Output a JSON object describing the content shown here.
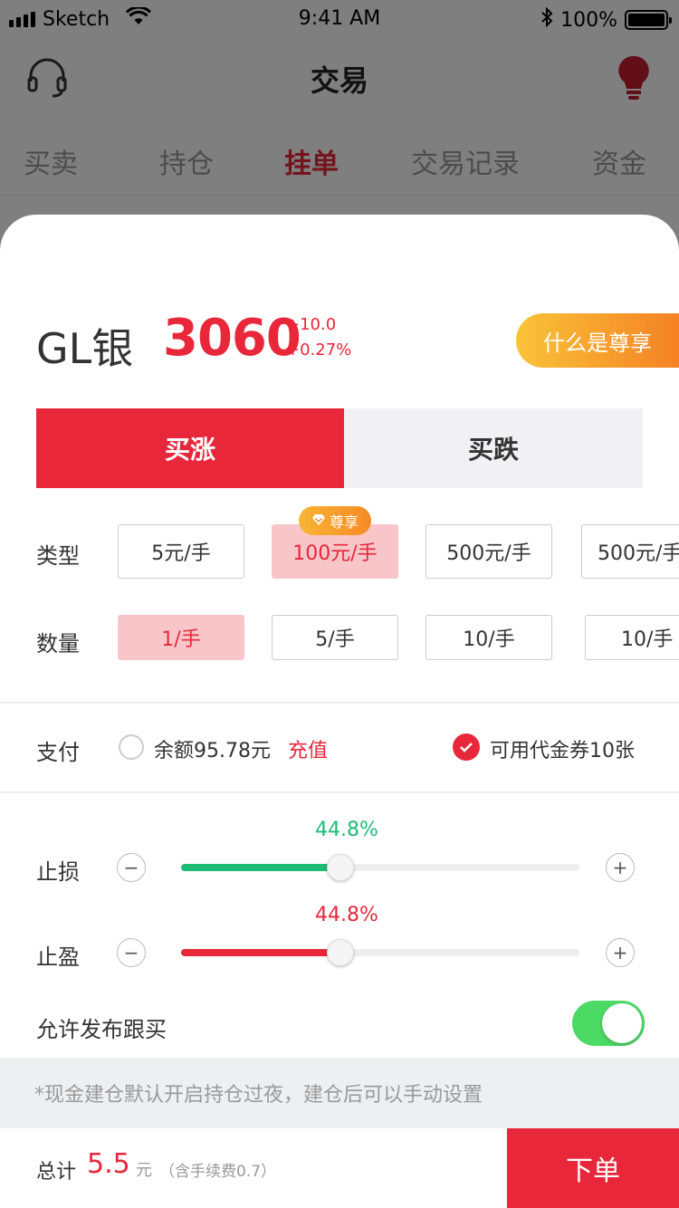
{
  "status_bar": {
    "carrier": "Sketch",
    "time": "9:41 AM",
    "battery": "100%"
  },
  "nav": {
    "title": "交易"
  },
  "tabs": [
    {
      "label": "买卖"
    },
    {
      "label": "持仓"
    },
    {
      "label": "挂单"
    },
    {
      "label": "交易记录"
    },
    {
      "label": "资金"
    }
  ],
  "product": {
    "name": "GL银",
    "price": "3060",
    "change": "+10.0",
    "change_pct": "+0.27%",
    "vip_label": "什么是尊享"
  },
  "direction": {
    "buy_up": "买涨",
    "buy_down": "买跌"
  },
  "type_row": {
    "label": "类型",
    "badge": "尊享",
    "options": [
      "5元/手",
      "100元/手",
      "500元/手",
      "500元/手"
    ]
  },
  "qty_row": {
    "label": "数量",
    "options": [
      "1/手",
      "5/手",
      "10/手",
      "10/手"
    ]
  },
  "payment": {
    "label": "支付",
    "balance": "余额95.78元",
    "recharge": "充值",
    "coupon": "可用代金券10张"
  },
  "stop_loss": {
    "label": "止损",
    "pct": "44.8%",
    "minus": "−",
    "plus": "+",
    "fill": 0.4
  },
  "take_profit": {
    "label": "止盈",
    "pct": "44.8%",
    "minus": "−",
    "plus": "+",
    "fill": 0.4
  },
  "follow": {
    "label": "允许发布跟买",
    "enabled": true
  },
  "notice": "*现金建仓默认开启持仓过夜，建仓后可以手动设置",
  "footer": {
    "total_label": "总计",
    "amount": "5.5",
    "unit": "元",
    "fee": "（含手续费0.7）",
    "submit": "下单"
  },
  "colors": {
    "accent": "#e8273a",
    "green": "#1dbb76",
    "toggle": "#4cd964",
    "vip_from": "#f9c338",
    "vip_to": "#f57a22"
  }
}
